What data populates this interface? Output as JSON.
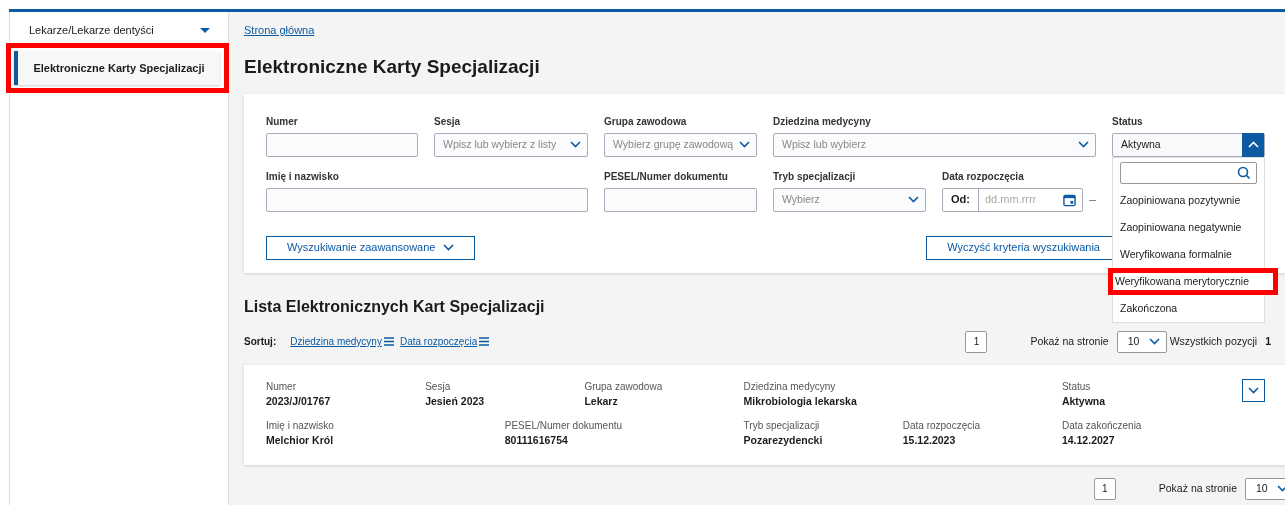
{
  "sidebar": {
    "group": "Lekarze/Lekarze dentyści",
    "expanded": true,
    "items": [
      {
        "label": "Elektroniczne Karty Specjalizacji",
        "selected": true,
        "highlighted": true
      }
    ]
  },
  "breadcrumb": "Strona główna",
  "title": "Elektroniczne Karty Specjalizacji",
  "filters": [
    {
      "label": "Numer",
      "kind": "text"
    },
    {
      "label": "Sesja",
      "kind": "select",
      "placeholder": "Wpisz lub wybierz z listy"
    },
    {
      "label": "Grupa zawodowa",
      "kind": "select",
      "placeholder": "Wybierz grupę zawodową"
    },
    {
      "label": "Dziedzina medycyny",
      "kind": "select",
      "placeholder": "Wpisz lub wybierz"
    },
    {
      "label": "Status",
      "kind": "select",
      "value": "Aktywna",
      "expanded": true
    },
    {
      "label": "Imię i nazwisko",
      "kind": "text"
    },
    {
      "label": "PESEL/Numer dokumentu",
      "kind": "text"
    },
    {
      "label": "Tryb specjalizacji",
      "kind": "select",
      "placeholder": "Wybierz"
    },
    {
      "label": "Data rozpoczęcia",
      "kind": "date",
      "prefix": "Od:",
      "placeholder": "dd.mm.rrrr",
      "separator": "–"
    }
  ],
  "status_options": [
    {
      "label": "Zaopiniowana pozytywnie",
      "selected": false,
      "highlighted": false
    },
    {
      "label": "Zaopiniowana negatywnie",
      "selected": false,
      "highlighted": false
    },
    {
      "label": "Weryfikowana formalnie",
      "selected": false,
      "highlighted": false
    },
    {
      "label": "Weryfikowana merytorycznie",
      "selected": false,
      "highlighted": true
    },
    {
      "label": "Zakończona",
      "selected": false,
      "highlighted": false
    }
  ],
  "buttons": [
    {
      "label": "Wyszukiwanie zaawansowane",
      "kind": "toggle"
    },
    {
      "label": "Wyczyść kryteria wyszukiwania",
      "kind": "plain"
    }
  ],
  "list": {
    "title": "Lista Elektronicznych Kart Specjalizacji",
    "sort_label": "Sortuj:",
    "sort_options": [
      "Dziedzina medycyny",
      "Data rozpoczęcia"
    ],
    "pagination": {
      "page": "1",
      "per_page_label": "Pokaż na stronie",
      "per_page": "10",
      "total_label": "Wszystkich pozycji",
      "total": "1"
    },
    "cards": [
      {
        "expanded": false,
        "fields": [
          {
            "label": "Numer",
            "value": "2023/J/01767"
          },
          {
            "label": "Sesja",
            "value": "Jesień 2023"
          },
          {
            "label": "Grupa zawodowa",
            "value": "Lekarz"
          },
          {
            "label": "Dziedzina medycyny",
            "value": "Mikrobiologia lekarska"
          },
          {
            "label": "Status",
            "value": "Aktywna"
          },
          {
            "label": "Imię i nazwisko",
            "value": "Melchior Król"
          },
          {
            "label": "PESEL/Numer dokumentu",
            "value": "80111616754"
          },
          {
            "label": "Tryb specjalizacji",
            "value": "Pozarezydencki"
          },
          {
            "label": "Data rozpoczęcia",
            "value": "15.12.2023"
          },
          {
            "label": "Data zakończenia",
            "value": "14.12.2027"
          }
        ]
      }
    ],
    "bottom_pagination": {
      "page": "1",
      "per_page_label": "Pokaż na stronie",
      "per_page": "10"
    }
  }
}
